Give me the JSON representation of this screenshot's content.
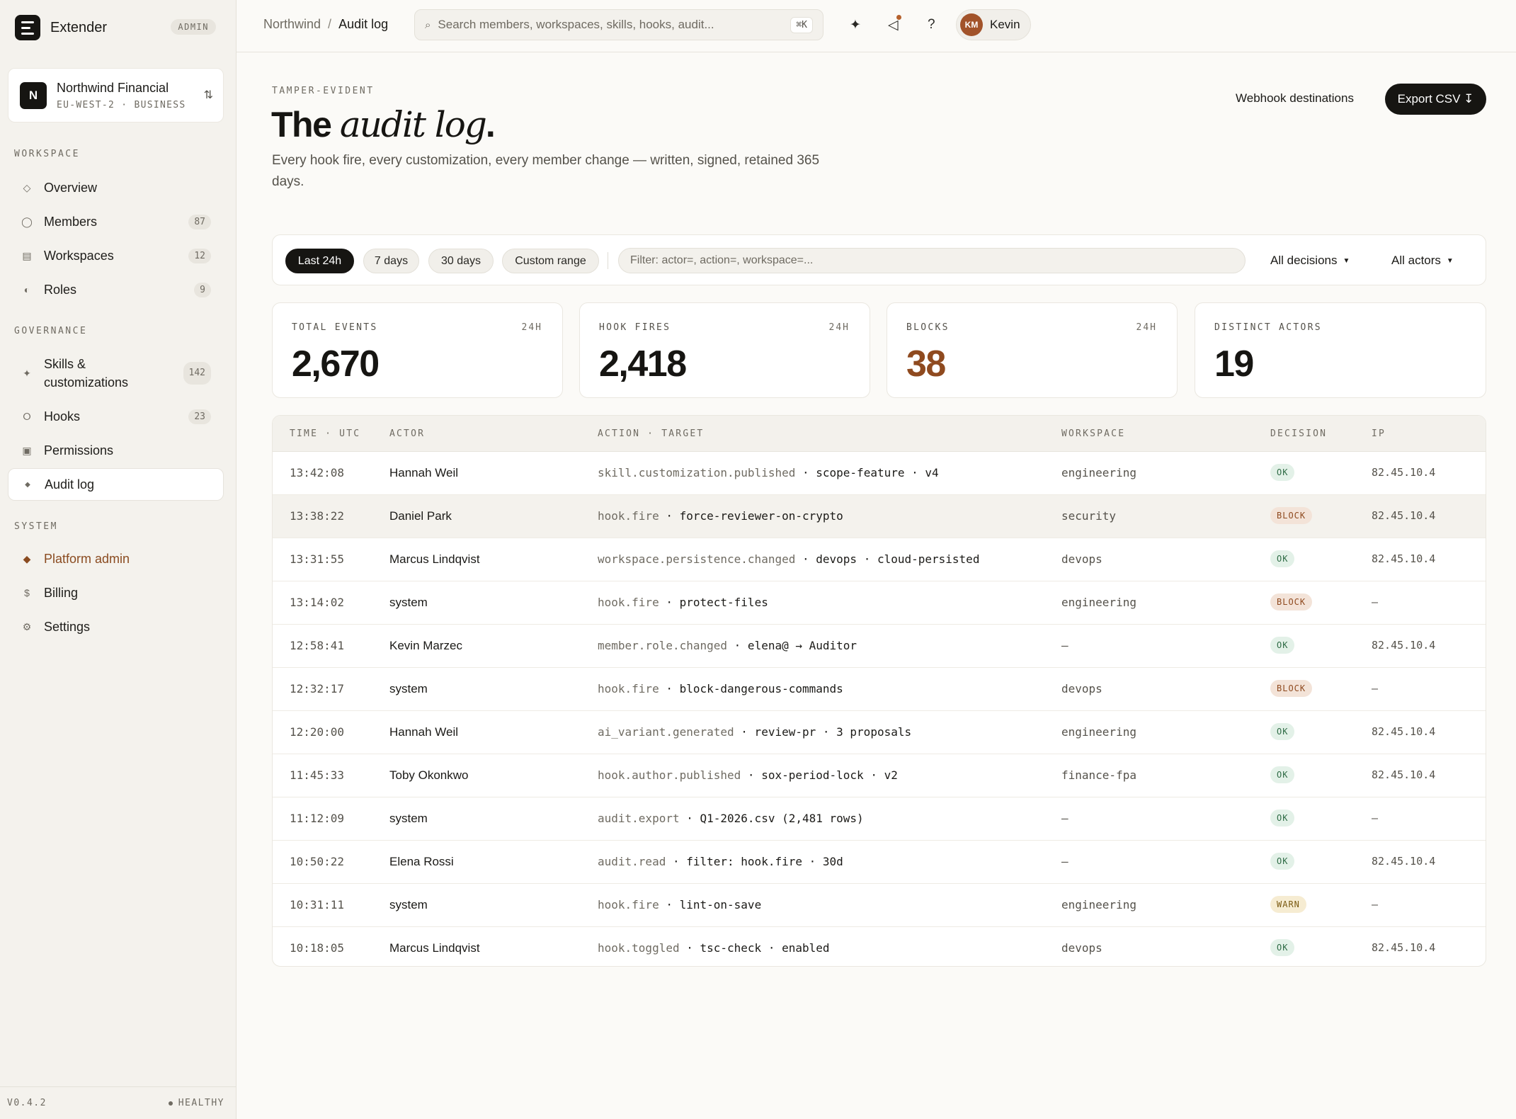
{
  "app": {
    "name": "Extender",
    "role_badge": "ADMIN",
    "version": "V0.4.2",
    "health": "HEALTHY"
  },
  "org": {
    "name": "Northwind Financial",
    "region": "EU-WEST-2",
    "plan": "BUSINESS",
    "initial": "N"
  },
  "sidebar": {
    "sections": [
      {
        "title": "WORKSPACE",
        "items": [
          {
            "label": "Overview",
            "icon": "diamond-icon"
          },
          {
            "label": "Members",
            "count": "87",
            "icon": "circle-icon"
          },
          {
            "label": "Workspaces",
            "count": "12",
            "icon": "grid-icon"
          },
          {
            "label": "Roles",
            "count": "9",
            "icon": "half-circle-icon"
          }
        ]
      },
      {
        "title": "GOVERNANCE",
        "items": [
          {
            "label": "Skills & customizations",
            "count": "142",
            "icon": "sparkle-icon"
          },
          {
            "label": "Hooks",
            "count": "23",
            "icon": "ring-icon"
          },
          {
            "label": "Permissions",
            "icon": "square-icon"
          },
          {
            "label": "Audit log",
            "icon": "small-diamond-icon",
            "active": true
          }
        ]
      },
      {
        "title": "SYSTEM",
        "items": [
          {
            "label": "Platform admin",
            "icon": "filled-diamond-icon",
            "accent": "#8a4b20"
          },
          {
            "label": "Billing",
            "icon": "dollar-icon"
          },
          {
            "label": "Settings",
            "icon": "gear-icon"
          }
        ]
      }
    ]
  },
  "topbar": {
    "breadcrumb": {
      "parent": "Northwind",
      "separator": "/",
      "current": "Audit log"
    },
    "search": {
      "placeholder": "Search members, workspaces, skills, hooks, audit...",
      "shortcut": "⌘K"
    },
    "user": {
      "initials": "KM",
      "name": "Kevin"
    }
  },
  "header": {
    "eyebrow": "TAMPER-EVIDENT",
    "title_prefix": "The",
    "title_italic": "audit log",
    "title_suffix": ".",
    "description": "Every hook fire, every customization, every member change — written, signed, retained 365 days.",
    "secondary_button": "Webhook destinations",
    "primary_button": "Export CSV ↧"
  },
  "filters": {
    "ranges": [
      "Last 24h",
      "7 days",
      "30 days",
      "Custom range"
    ],
    "active_range": "Last 24h",
    "query_placeholder": "Filter: actor=, action=, workspace=...",
    "decision_select": "All decisions",
    "actor_select": "All actors"
  },
  "stats": [
    {
      "label": "TOTAL EVENTS",
      "period": "24H",
      "value": "2,670"
    },
    {
      "label": "HOOK FIRES",
      "period": "24H",
      "value": "2,418"
    },
    {
      "label": "BLOCKS",
      "period": "24H",
      "value": "38",
      "accent": "#8f4a1f"
    },
    {
      "label": "DISTINCT ACTORS",
      "period": "",
      "value": "19"
    }
  ],
  "table": {
    "columns": [
      "TIME · UTC",
      "ACTOR",
      "ACTION · TARGET",
      "WORKSPACE",
      "DECISION",
      "IP"
    ],
    "rows": [
      {
        "time": "13:42:08",
        "actor": "Hannah Weil",
        "action": "skill.customization.published",
        "target": " · scope-feature · v4",
        "workspace": "engineering",
        "decision": "OK",
        "ip": "82.45.10.4"
      },
      {
        "time": "13:38:22",
        "actor": "Daniel Park",
        "action": "hook.fire",
        "target": " · force-reviewer-on-crypto",
        "workspace": "security",
        "decision": "BLOCK",
        "ip": "82.45.10.4",
        "highlight": true
      },
      {
        "time": "13:31:55",
        "actor": "Marcus Lindqvist",
        "action": "workspace.persistence.changed",
        "target": " · devops · cloud-persisted",
        "workspace": "devops",
        "decision": "OK",
        "ip": "82.45.10.4"
      },
      {
        "time": "13:14:02",
        "actor": "system",
        "action": "hook.fire",
        "target": " · protect-files",
        "workspace": "engineering",
        "decision": "BLOCK",
        "ip": "—"
      },
      {
        "time": "12:58:41",
        "actor": "Kevin Marzec",
        "action": "member.role.changed",
        "target": " · elena@ → Auditor",
        "workspace": "—",
        "decision": "OK",
        "ip": "82.45.10.4"
      },
      {
        "time": "12:32:17",
        "actor": "system",
        "action": "hook.fire",
        "target": " · block-dangerous-commands",
        "workspace": "devops",
        "decision": "BLOCK",
        "ip": "—"
      },
      {
        "time": "12:20:00",
        "actor": "Hannah Weil",
        "action": "ai_variant.generated",
        "target": " · review-pr · 3 proposals",
        "workspace": "engineering",
        "decision": "OK",
        "ip": "82.45.10.4"
      },
      {
        "time": "11:45:33",
        "actor": "Toby Okonkwo",
        "action": "hook.author.published",
        "target": " · sox-period-lock · v2",
        "workspace": "finance-fpa",
        "decision": "OK",
        "ip": "82.45.10.4"
      },
      {
        "time": "11:12:09",
        "actor": "system",
        "action": "audit.export",
        "target": " · Q1-2026.csv (2,481 rows)",
        "workspace": "—",
        "decision": "OK",
        "ip": "—"
      },
      {
        "time": "10:50:22",
        "actor": "Elena Rossi",
        "action": "audit.read",
        "target": " · filter: hook.fire · 30d",
        "workspace": "—",
        "decision": "OK",
        "ip": "82.45.10.4"
      },
      {
        "time": "10:31:11",
        "actor": "system",
        "action": "hook.fire",
        "target": " · lint-on-save",
        "workspace": "engineering",
        "decision": "WARN",
        "ip": "—"
      },
      {
        "time": "10:18:05",
        "actor": "Marcus Lindqvist",
        "action": "hook.toggled",
        "target": " · tsc-check · enabled",
        "workspace": "devops",
        "decision": "OK",
        "ip": "82.45.10.4"
      }
    ]
  }
}
